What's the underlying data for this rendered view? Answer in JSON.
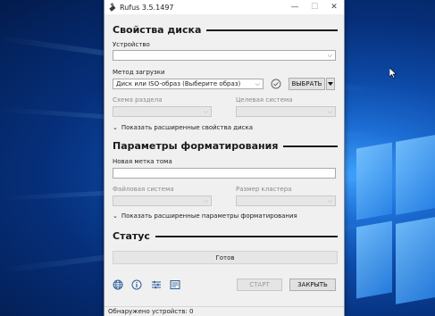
{
  "window": {
    "title": "Rufus 3.5.1497",
    "minimize_glyph": "—",
    "maximize_glyph": "☐",
    "close_glyph": "✕"
  },
  "drive_properties": {
    "heading": "Свойства диска",
    "device_label": "Устройство",
    "device_value": "",
    "boot_selection_label": "Метод загрузки",
    "boot_selection_value": "Диск или ISO-образ (Выберите образ)",
    "select_button": "ВЫБРАТЬ",
    "partition_scheme_label": "Схема раздела",
    "target_system_label": "Целевая система",
    "advanced_toggle": "Показать расширенные свойства диска"
  },
  "format_options": {
    "heading": "Параметры форматирования",
    "volume_label_label": "Новая метка тома",
    "volume_label_value": "",
    "file_system_label": "Файловая система",
    "cluster_size_label": "Размер кластера",
    "advanced_toggle": "Показать расширенные параметры форматирования"
  },
  "status": {
    "heading": "Статус",
    "text": "Готов"
  },
  "actions": {
    "start_button": "СТАРТ",
    "close_button": "ЗАКРЫТЬ"
  },
  "footer": {
    "text": "Обнаружено устройств: 0"
  },
  "icons": [
    "globe-icon",
    "info-icon",
    "settings-icon",
    "log-icon",
    "check-icon",
    "usb-icon"
  ]
}
